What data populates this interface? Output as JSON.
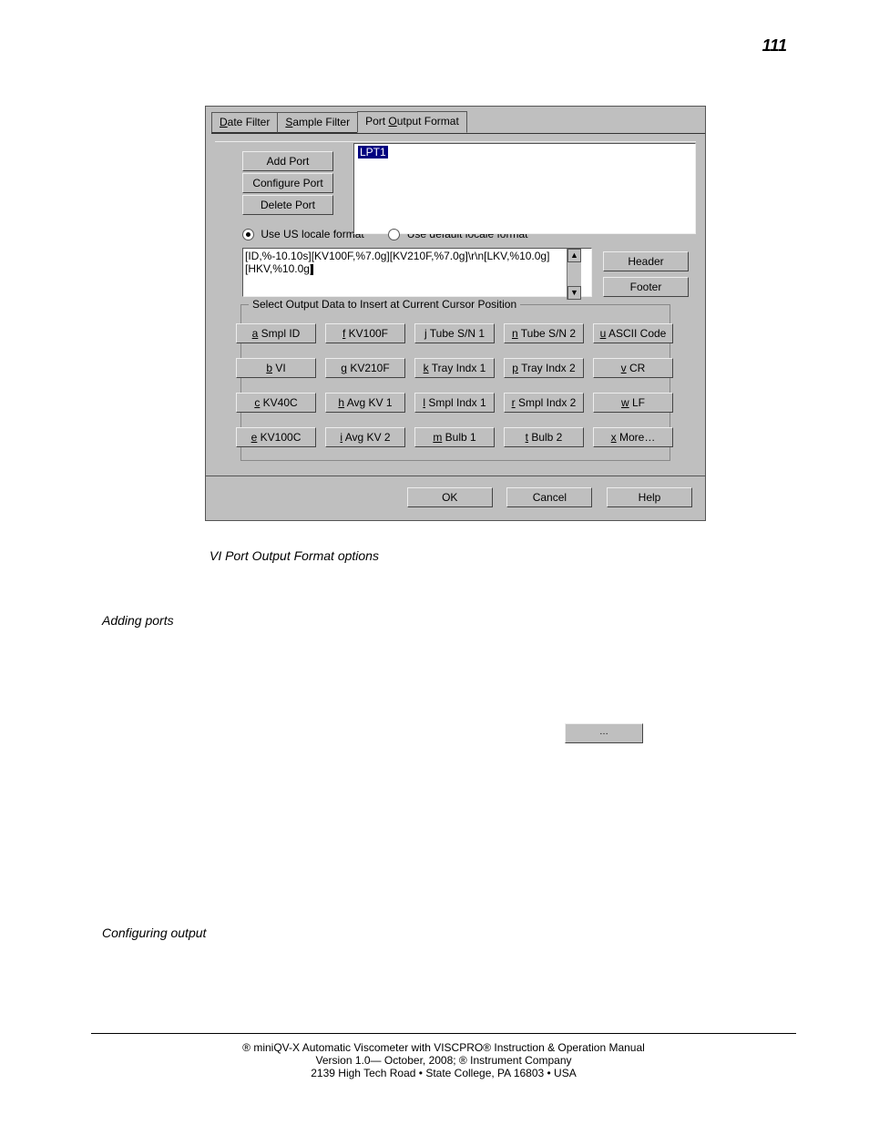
{
  "page_number": "111",
  "dialog": {
    "tabs": {
      "date": "Date Filter",
      "sample": "Sample Filter",
      "port": "Port Output Format",
      "date_hotkey": "D",
      "sample_hotkey": "S",
      "port_hotkey": "O"
    },
    "port_buttons": {
      "add": "Add Port",
      "configure": "Configure Port",
      "delete": "Delete Port"
    },
    "port_list_selected": "LPT1",
    "locale": {
      "us": "Use US locale format",
      "default": "Use default locale format",
      "us_checked": true
    },
    "format_line1": "[ID,%-10.10s][KV100F,%7.0g][KV210F,%7.0g]\\r\\n[LKV,%10.0g]",
    "format_line2": "[HKV,%10.0g]",
    "header_btn": "Header",
    "footer_btn": "Footer",
    "fieldset_legend": "Select Output Data to Insert at Current Cursor Position",
    "grid": {
      "r1c1": {
        "hk": "a",
        "label": " Smpl ID"
      },
      "r1c2": {
        "hk": "f",
        "label": " KV100F"
      },
      "r1c3": {
        "hk": "j",
        "label": " Tube S/N 1"
      },
      "r1c4": {
        "hk": "n",
        "label": " Tube S/N 2"
      },
      "r1c5": {
        "hk": "u",
        "label": " ASCII Code"
      },
      "r2c1": {
        "hk": "b",
        "label": " VI"
      },
      "r2c2": {
        "hk": "g",
        "label": " KV210F"
      },
      "r2c3": {
        "hk": "k",
        "label": " Tray Indx 1"
      },
      "r2c4": {
        "hk": "p",
        "label": " Tray Indx 2"
      },
      "r2c5": {
        "hk": "v",
        "label": " CR"
      },
      "r3c1": {
        "hk": "c",
        "label": " KV40C"
      },
      "r3c2": {
        "hk": "h",
        "label": " Avg KV 1"
      },
      "r3c3": {
        "hk": "l",
        "label": " Smpl Indx 1"
      },
      "r3c4": {
        "hk": "r",
        "label": " Smpl Indx 2"
      },
      "r3c5": {
        "hk": "w",
        "label": " LF"
      },
      "r4c1": {
        "hk": "e",
        "label": " KV100C"
      },
      "r4c2": {
        "hk": "i",
        "label": " Avg KV 2"
      },
      "r4c3": {
        "hk": "m",
        "label": " Bulb 1"
      },
      "r4c4": {
        "hk": "t",
        "label": " Bulb 2"
      },
      "r4c5": {
        "hk": "x",
        "label": " More…"
      }
    },
    "footer_buttons": {
      "ok": "OK",
      "cancel": "Cancel",
      "help": "Help"
    }
  },
  "caption_dialog": "VI Port Output Format options",
  "heading_adding": "Adding ports",
  "lonely_button": "…",
  "heading_configuring": "Configuring output",
  "footer": {
    "line1": "® miniQV-X Automatic Viscometer with VISCPRO® Instruction & Operation Manual",
    "line2": "Version 1.0— October, 2008;       ® Instrument Company",
    "line3": "2139 High Tech Road • State College, PA  16803 • USA"
  }
}
